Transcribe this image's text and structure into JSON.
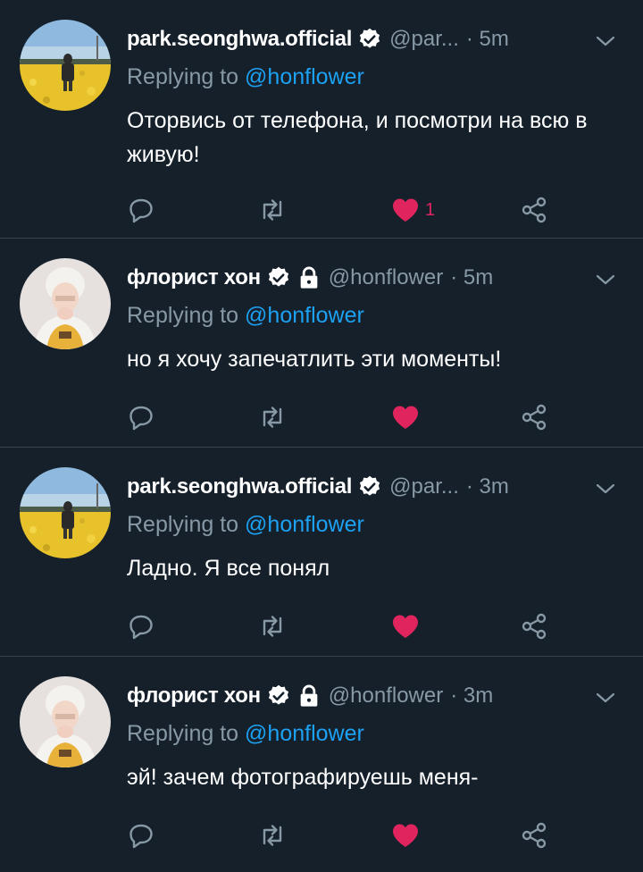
{
  "colors": {
    "background": "#15202b",
    "divider": "#38444d",
    "muted": "#8899a6",
    "link": "#1da1f2",
    "like": "#e0245e"
  },
  "tweets": [
    {
      "name": "park.seonghwa.official",
      "handle": "@par...",
      "time": "· 5m",
      "verified": true,
      "locked": false,
      "replying_prefix": "Replying to",
      "replying_to": "@honflower",
      "text": "Оторвись от телефона, и посмотри на всю в живую!",
      "like_count": "1",
      "avatar": "field-photo"
    },
    {
      "name": "флорист хон",
      "handle": "@honflower",
      "time": "· 5m",
      "verified": true,
      "locked": true,
      "replying_prefix": "Replying to",
      "replying_to": "@honflower",
      "text": "но я хочу запечатлить эти моменты!",
      "like_count": "",
      "avatar": "person-photo"
    },
    {
      "name": "park.seonghwa.official",
      "handle": "@par...",
      "time": "· 3m",
      "verified": true,
      "locked": false,
      "replying_prefix": "Replying to",
      "replying_to": "@honflower",
      "text": "Ладно. Я все понял",
      "like_count": "",
      "avatar": "field-photo"
    },
    {
      "name": "флорист хон",
      "handle": "@honflower",
      "time": "· 3m",
      "verified": true,
      "locked": true,
      "replying_prefix": "Replying to",
      "replying_to": "@honflower",
      "text": "эй! зачем фотографируешь меня-",
      "like_count": "",
      "avatar": "person-photo"
    }
  ],
  "icons": {
    "reply": "reply-icon",
    "retweet": "retweet-icon",
    "like": "heart-icon",
    "share": "share-icon",
    "verified": "verified-badge-icon",
    "locked": "lock-icon",
    "more": "chevron-down-icon"
  }
}
